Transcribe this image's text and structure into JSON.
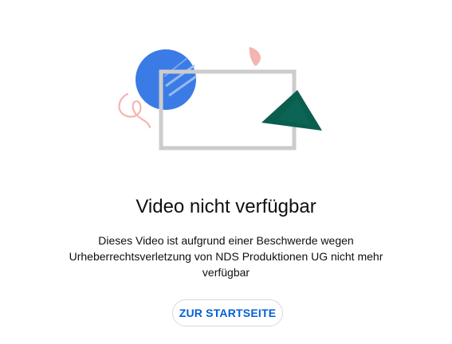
{
  "error": {
    "title": "Video nicht verfügbar",
    "message": "Dieses Video ist aufgrund einer Beschwerde wegen Urheberrechtsverletzung von NDS Produktionen UG nicht mehr verfügbar"
  },
  "actions": {
    "home_button_label": "ZUR STARTSEITE"
  },
  "colors": {
    "accent": "#065fd4",
    "circle": "#3b7be6",
    "frame": "#cccccc",
    "triangle": "#0a5e4e",
    "pink": "#f4b5b0"
  },
  "illustration": {
    "icons": [
      "blue-circle-icon",
      "pink-squiggle-icon",
      "pink-half-circle-icon",
      "video-frame-icon",
      "green-triangle-icon"
    ]
  }
}
